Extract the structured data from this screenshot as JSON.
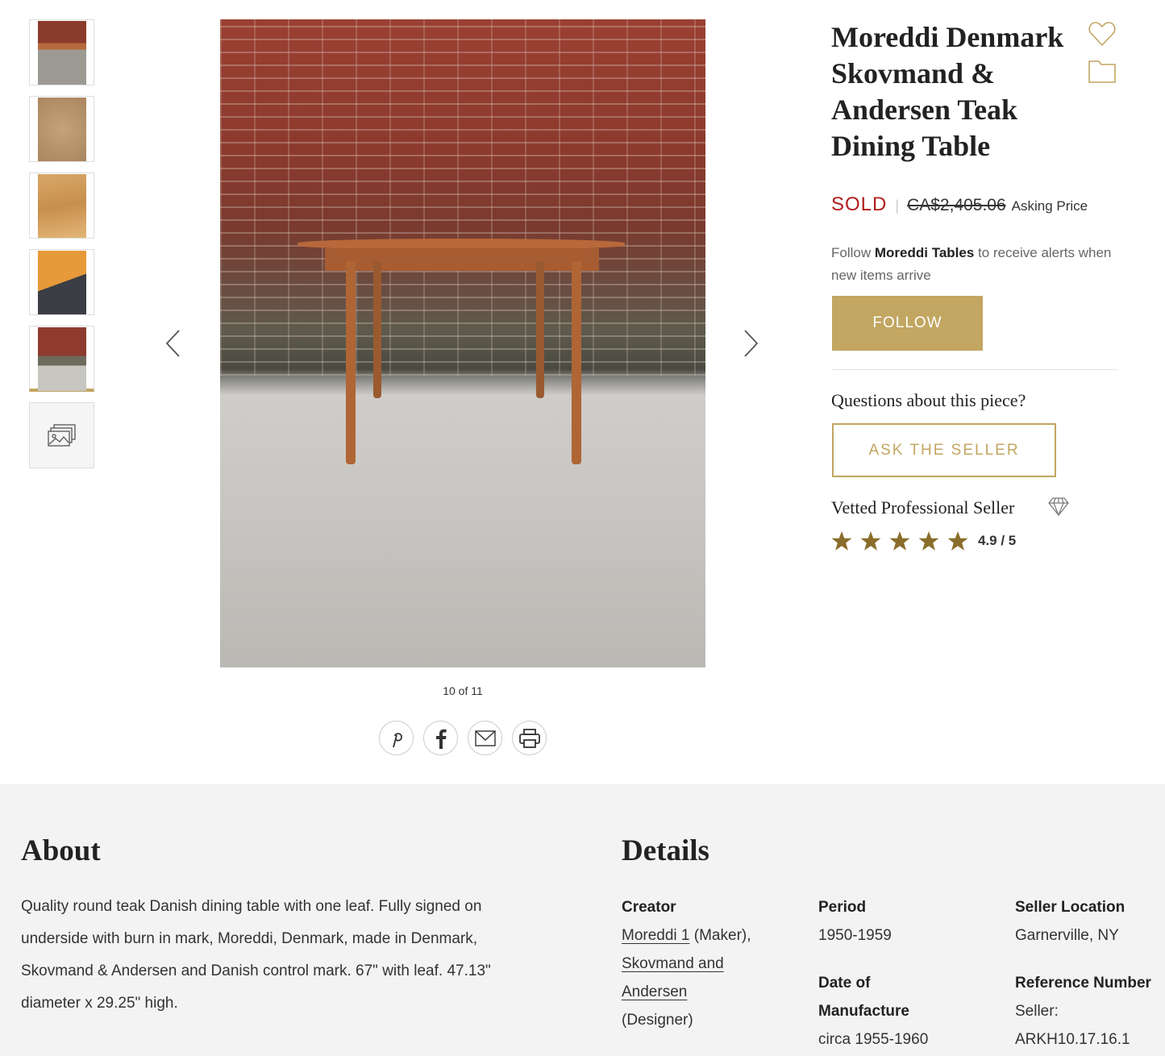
{
  "gallery": {
    "thumbnails": [
      {
        "name": "thumbnail-1"
      },
      {
        "name": "thumbnail-2"
      },
      {
        "name": "thumbnail-3"
      },
      {
        "name": "thumbnail-4"
      },
      {
        "name": "thumbnail-5",
        "active": true
      },
      {
        "name": "more-images",
        "icon": "images-icon"
      }
    ],
    "counter": "10 of 11",
    "share_icons": [
      "pinterest-icon",
      "facebook-icon",
      "email-icon",
      "print-icon"
    ]
  },
  "product": {
    "title": "Moreddi Denmark Skovmand & Andersen Teak Dining Table",
    "status": "SOLD",
    "separator": "|",
    "price": "CA$2,405.06",
    "price_label": "Asking Price"
  },
  "follow": {
    "prefix": "Follow ",
    "seller": "Moreddi Tables",
    "suffix": " to receive alerts when new items arrive",
    "button": "FOLLOW"
  },
  "questions": {
    "heading": "Questions about this piece?",
    "button": "ASK THE SELLER"
  },
  "seller": {
    "vetted_label": "Vetted Professional Seller",
    "rating": "4.9 / 5",
    "stars": 5
  },
  "about": {
    "heading": "About",
    "text": "Quality round teak Danish dining table with one leaf. Fully signed on underside with burn in mark, Moreddi, Denmark, made in Denmark, Skovmand & Andersen and Danish control mark. 67\" with leaf. 47.13\" diameter x 29.25\" high."
  },
  "details": {
    "heading": "Details",
    "creator_label": "Creator",
    "creator_1": "Moreddi 1",
    "creator_1_role": " (Maker),",
    "creator_2": "Skovmand and Andersen",
    "creator_2_role": "(Designer)",
    "period_label": "Period",
    "period": "1950-1959",
    "date_label": "Date of Manufacture",
    "date": "circa 1955-1960",
    "location_label": "Seller Location",
    "location": "Garnerville, NY",
    "reference_label": "Reference Number",
    "reference": "Seller: ARKH10.17.16.1"
  },
  "colors": {
    "accent": "#c2a661",
    "sold": "#b21c1c",
    "star": "#8a6d2b"
  }
}
